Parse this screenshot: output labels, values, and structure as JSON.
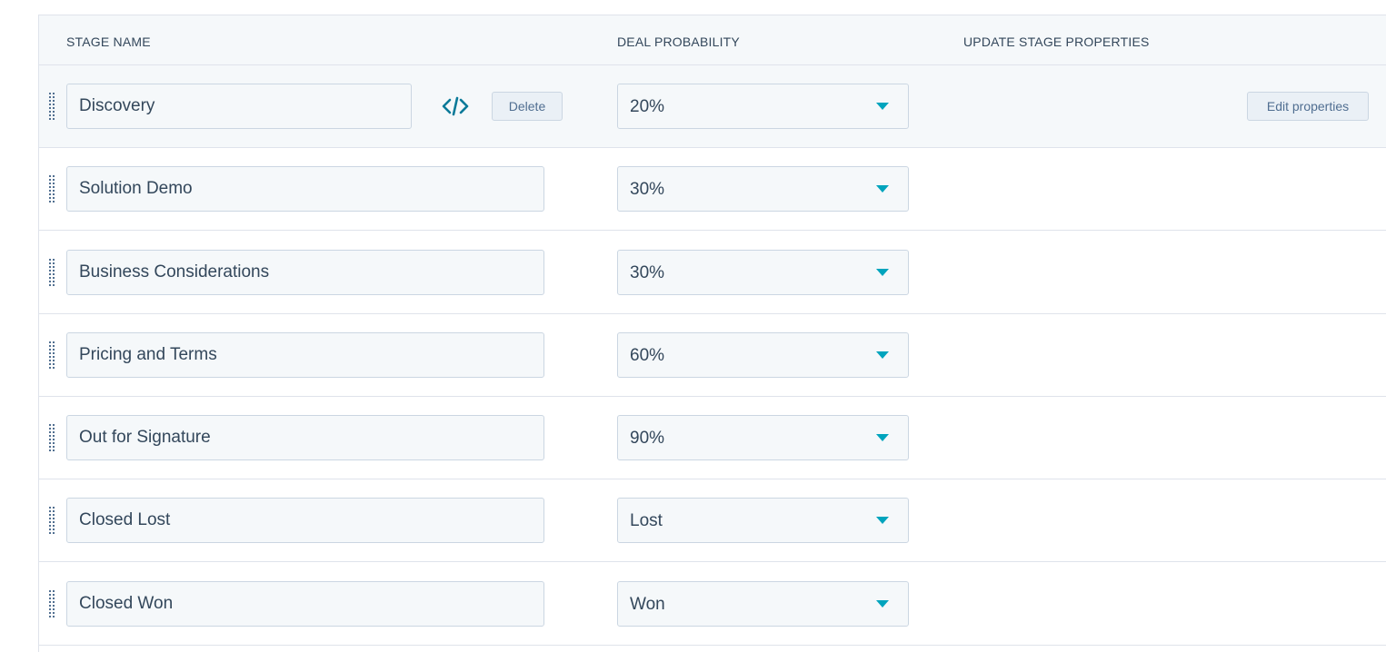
{
  "header": {
    "stage_name": "STAGE NAME",
    "deal_probability": "DEAL PROBABILITY",
    "update_stage_properties": "UPDATE STAGE PROPERTIES"
  },
  "stages": [
    {
      "name": "Discovery",
      "probability": "20%"
    },
    {
      "name": "Solution Demo",
      "probability": "30%"
    },
    {
      "name": "Business Considerations",
      "probability": "30%"
    },
    {
      "name": "Pricing and Terms",
      "probability": "60%"
    },
    {
      "name": "Out for Signature",
      "probability": "90%"
    },
    {
      "name": "Closed Lost",
      "probability": "Lost"
    },
    {
      "name": "Closed Won",
      "probability": "Won"
    }
  ],
  "actions": {
    "delete_label": "Delete",
    "edit_properties_label": "Edit properties"
  },
  "icons": {
    "drag": "drag-handle-icon",
    "code": "code-embed-icon",
    "caret": "caret-down-icon"
  },
  "colors": {
    "accent": "#00a4bd",
    "code_icon": "#0b7a99",
    "text": "#33475b",
    "field_bg": "#f5f8fa",
    "border": "#cbd6e2"
  }
}
